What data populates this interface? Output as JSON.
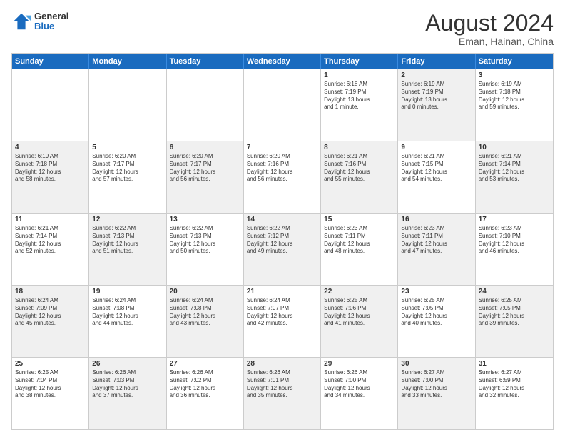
{
  "header": {
    "logo_line1": "General",
    "logo_line2": "Blue",
    "month_year": "August 2024",
    "location": "Eman, Hainan, China"
  },
  "days_of_week": [
    "Sunday",
    "Monday",
    "Tuesday",
    "Wednesday",
    "Thursday",
    "Friday",
    "Saturday"
  ],
  "rows": [
    [
      {
        "day": "",
        "text": "",
        "shade": "empty"
      },
      {
        "day": "",
        "text": "",
        "shade": "empty"
      },
      {
        "day": "",
        "text": "",
        "shade": "empty"
      },
      {
        "day": "",
        "text": "",
        "shade": "empty"
      },
      {
        "day": "1",
        "text": "Sunrise: 6:18 AM\nSunset: 7:19 PM\nDaylight: 13 hours\nand 1 minute.",
        "shade": "white"
      },
      {
        "day": "2",
        "text": "Sunrise: 6:19 AM\nSunset: 7:19 PM\nDaylight: 13 hours\nand 0 minutes.",
        "shade": "shaded"
      },
      {
        "day": "3",
        "text": "Sunrise: 6:19 AM\nSunset: 7:18 PM\nDaylight: 12 hours\nand 59 minutes.",
        "shade": "white"
      }
    ],
    [
      {
        "day": "4",
        "text": "Sunrise: 6:19 AM\nSunset: 7:18 PM\nDaylight: 12 hours\nand 58 minutes.",
        "shade": "shaded"
      },
      {
        "day": "5",
        "text": "Sunrise: 6:20 AM\nSunset: 7:17 PM\nDaylight: 12 hours\nand 57 minutes.",
        "shade": "white"
      },
      {
        "day": "6",
        "text": "Sunrise: 6:20 AM\nSunset: 7:17 PM\nDaylight: 12 hours\nand 56 minutes.",
        "shade": "shaded"
      },
      {
        "day": "7",
        "text": "Sunrise: 6:20 AM\nSunset: 7:16 PM\nDaylight: 12 hours\nand 56 minutes.",
        "shade": "white"
      },
      {
        "day": "8",
        "text": "Sunrise: 6:21 AM\nSunset: 7:16 PM\nDaylight: 12 hours\nand 55 minutes.",
        "shade": "shaded"
      },
      {
        "day": "9",
        "text": "Sunrise: 6:21 AM\nSunset: 7:15 PM\nDaylight: 12 hours\nand 54 minutes.",
        "shade": "white"
      },
      {
        "day": "10",
        "text": "Sunrise: 6:21 AM\nSunset: 7:14 PM\nDaylight: 12 hours\nand 53 minutes.",
        "shade": "shaded"
      }
    ],
    [
      {
        "day": "11",
        "text": "Sunrise: 6:21 AM\nSunset: 7:14 PM\nDaylight: 12 hours\nand 52 minutes.",
        "shade": "white"
      },
      {
        "day": "12",
        "text": "Sunrise: 6:22 AM\nSunset: 7:13 PM\nDaylight: 12 hours\nand 51 minutes.",
        "shade": "shaded"
      },
      {
        "day": "13",
        "text": "Sunrise: 6:22 AM\nSunset: 7:13 PM\nDaylight: 12 hours\nand 50 minutes.",
        "shade": "white"
      },
      {
        "day": "14",
        "text": "Sunrise: 6:22 AM\nSunset: 7:12 PM\nDaylight: 12 hours\nand 49 minutes.",
        "shade": "shaded"
      },
      {
        "day": "15",
        "text": "Sunrise: 6:23 AM\nSunset: 7:11 PM\nDaylight: 12 hours\nand 48 minutes.",
        "shade": "white"
      },
      {
        "day": "16",
        "text": "Sunrise: 6:23 AM\nSunset: 7:11 PM\nDaylight: 12 hours\nand 47 minutes.",
        "shade": "shaded"
      },
      {
        "day": "17",
        "text": "Sunrise: 6:23 AM\nSunset: 7:10 PM\nDaylight: 12 hours\nand 46 minutes.",
        "shade": "white"
      }
    ],
    [
      {
        "day": "18",
        "text": "Sunrise: 6:24 AM\nSunset: 7:09 PM\nDaylight: 12 hours\nand 45 minutes.",
        "shade": "shaded"
      },
      {
        "day": "19",
        "text": "Sunrise: 6:24 AM\nSunset: 7:08 PM\nDaylight: 12 hours\nand 44 minutes.",
        "shade": "white"
      },
      {
        "day": "20",
        "text": "Sunrise: 6:24 AM\nSunset: 7:08 PM\nDaylight: 12 hours\nand 43 minutes.",
        "shade": "shaded"
      },
      {
        "day": "21",
        "text": "Sunrise: 6:24 AM\nSunset: 7:07 PM\nDaylight: 12 hours\nand 42 minutes.",
        "shade": "white"
      },
      {
        "day": "22",
        "text": "Sunrise: 6:25 AM\nSunset: 7:06 PM\nDaylight: 12 hours\nand 41 minutes.",
        "shade": "shaded"
      },
      {
        "day": "23",
        "text": "Sunrise: 6:25 AM\nSunset: 7:05 PM\nDaylight: 12 hours\nand 40 minutes.",
        "shade": "white"
      },
      {
        "day": "24",
        "text": "Sunrise: 6:25 AM\nSunset: 7:05 PM\nDaylight: 12 hours\nand 39 minutes.",
        "shade": "shaded"
      }
    ],
    [
      {
        "day": "25",
        "text": "Sunrise: 6:25 AM\nSunset: 7:04 PM\nDaylight: 12 hours\nand 38 minutes.",
        "shade": "white"
      },
      {
        "day": "26",
        "text": "Sunrise: 6:26 AM\nSunset: 7:03 PM\nDaylight: 12 hours\nand 37 minutes.",
        "shade": "shaded"
      },
      {
        "day": "27",
        "text": "Sunrise: 6:26 AM\nSunset: 7:02 PM\nDaylight: 12 hours\nand 36 minutes.",
        "shade": "white"
      },
      {
        "day": "28",
        "text": "Sunrise: 6:26 AM\nSunset: 7:01 PM\nDaylight: 12 hours\nand 35 minutes.",
        "shade": "shaded"
      },
      {
        "day": "29",
        "text": "Sunrise: 6:26 AM\nSunset: 7:00 PM\nDaylight: 12 hours\nand 34 minutes.",
        "shade": "white"
      },
      {
        "day": "30",
        "text": "Sunrise: 6:27 AM\nSunset: 7:00 PM\nDaylight: 12 hours\nand 33 minutes.",
        "shade": "shaded"
      },
      {
        "day": "31",
        "text": "Sunrise: 6:27 AM\nSunset: 6:59 PM\nDaylight: 12 hours\nand 32 minutes.",
        "shade": "white"
      }
    ]
  ]
}
